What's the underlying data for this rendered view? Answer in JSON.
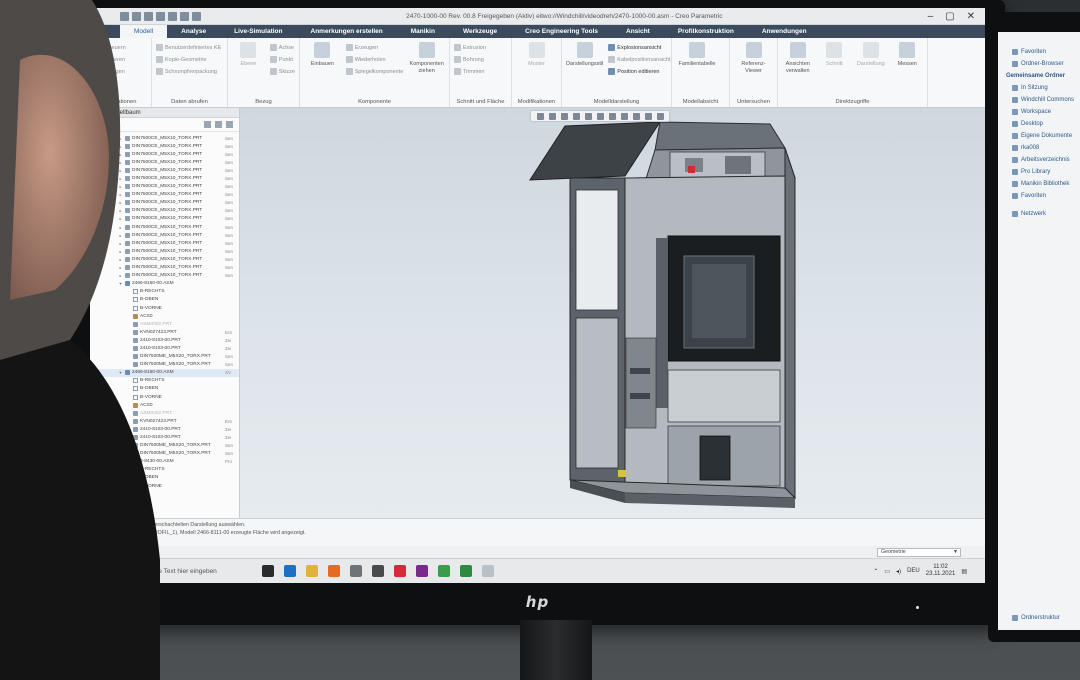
{
  "window": {
    "title": "2470-1000-00 Rev. 00.8 Freigegeben  (Aktiv) eitwo://Windchill/videodreh/2470-1000-00.asm - Creo Parametric",
    "controls": [
      "–",
      "▢",
      "✕"
    ]
  },
  "ribbon": {
    "tabs": [
      {
        "label": "Modell",
        "active": true
      },
      {
        "label": "Analyse"
      },
      {
        "label": "Live-Simulation"
      },
      {
        "label": "Anmerkungen erstellen"
      },
      {
        "label": "Manikin"
      },
      {
        "label": "Werkzeuge"
      },
      {
        "label": "Creo Engineering Tools"
      },
      {
        "label": "Ansicht"
      },
      {
        "label": "Profilkonstruktion"
      },
      {
        "label": "Anwendungen"
      }
    ],
    "groups": {
      "operationen": {
        "label": "Operationen",
        "commands": [
          "Erneuern",
          "Kopieren",
          "Einfügen"
        ]
      },
      "daten_abrufen": {
        "label": "Daten abrufen",
        "commands": [
          "Benutzerdefiniertes KE",
          "Kopie-Geometrie",
          "Schrumpfverpackung"
        ]
      },
      "bezug": {
        "label": "Bezug",
        "commands": [
          "Ebene",
          "Achse",
          "Punkt",
          "Skizze"
        ]
      },
      "komponente": {
        "label": "Komponente",
        "big": [
          "Einbauen",
          "Komponenten ziehen"
        ],
        "commands": [
          "Erzeugen",
          "Wiederholen",
          "Spiegelkomponente"
        ]
      },
      "schnitt": {
        "label": "Schnitt und Fläche",
        "commands": [
          "Extrusion",
          "Bohrung",
          "Trimmen"
        ]
      },
      "modifikationen": {
        "label": "Modifikationen",
        "big": [
          "Muster"
        ]
      },
      "modelldarstellung": {
        "label": "Modelldarstellung",
        "big": [
          "Darstellungsstil"
        ],
        "commands": [
          "Explosionsansicht",
          "Kabelpositionsansicht",
          "Position editieren"
        ]
      },
      "modellabsicht": {
        "label": "Modellabsicht",
        "big": [
          "Familientabelle"
        ]
      },
      "untersuchen": {
        "label": "Untersuchen",
        "big": [
          "Referenz-Viewer"
        ]
      },
      "direktzugriffe": {
        "label": "Direktzugriffe",
        "big": [
          "Ansichten verwalten",
          "Schnitt",
          "Darstellung",
          "Messen"
        ]
      }
    }
  },
  "model_tree": {
    "header": "Modellbaum",
    "columns_label": "BENE",
    "rows": [
      {
        "label": "DIN7500CE_M5X10_TORX.PRT",
        "col": "Sen",
        "type": "part"
      },
      {
        "label": "DIN7500CE_M5X10_TORX.PRT",
        "col": "Sen",
        "type": "part"
      },
      {
        "label": "DIN7500CE_M5X10_TORX.PRT",
        "col": "Sen",
        "type": "part"
      },
      {
        "label": "DIN7500CE_M5X10_TORX.PRT",
        "col": "Sen",
        "type": "part"
      },
      {
        "label": "DIN7500CE_M5X10_TORX.PRT",
        "col": "Sen",
        "type": "part"
      },
      {
        "label": "DIN7500CE_M5X10_TORX.PRT",
        "col": "Sen",
        "type": "part"
      },
      {
        "label": "DIN7500CE_M5X10_TORX.PRT",
        "col": "Sen",
        "type": "part"
      },
      {
        "label": "DIN7500CE_M5X10_TORX.PRT",
        "col": "Sen",
        "type": "part"
      },
      {
        "label": "DIN7500CE_M5X10_TORX.PRT",
        "col": "Sen",
        "type": "part"
      },
      {
        "label": "DIN7500CE_M5X10_TORX.PRT",
        "col": "Sen",
        "type": "part"
      },
      {
        "label": "DIN7500CE_M5X10_TORX.PRT",
        "col": "Sen",
        "type": "part"
      },
      {
        "label": "DIN7500CE_M5X10_TORX.PRT",
        "col": "Sen",
        "type": "part"
      },
      {
        "label": "DIN7500CE_M5X10_TORX.PRT",
        "col": "Sen",
        "type": "part"
      },
      {
        "label": "DIN7500CE_M5X10_TORX.PRT",
        "col": "Sen",
        "type": "part"
      },
      {
        "label": "DIN7500CE_M5X10_TORX.PRT",
        "col": "Sen",
        "type": "part"
      },
      {
        "label": "DIN7500CE_M5X10_TORX.PRT",
        "col": "Sen",
        "type": "part"
      },
      {
        "label": "DIN7500CE_M5X10_TORX.PRT",
        "col": "Sen",
        "type": "part"
      },
      {
        "label": "DIN7500CE_M5X10_TORX.PRT",
        "col": "Sen",
        "type": "part"
      },
      {
        "label": "2466-8150-00.ASM",
        "col": "",
        "type": "asm"
      },
      {
        "label": "B-RECHTS",
        "col": "",
        "type": "plane",
        "indent": 1
      },
      {
        "label": "B-OBEN",
        "col": "",
        "type": "plane",
        "indent": 1
      },
      {
        "label": "B-VORNE",
        "col": "",
        "type": "plane",
        "indent": 1
      },
      {
        "label": "ACS0",
        "col": "",
        "type": "csys",
        "indent": 1
      },
      {
        "label": "ASM0002.PRT",
        "col": "",
        "type": "part",
        "indent": 1,
        "faded": true
      },
      {
        "label": "KVN027423.PRT",
        "col": "Ent",
        "type": "part",
        "indent": 1
      },
      {
        "label": "2410-8103-00.PRT",
        "col": "Zei",
        "type": "part",
        "indent": 1
      },
      {
        "label": "2410-8103-00.PRT",
        "col": "Zei",
        "type": "part",
        "indent": 1
      },
      {
        "label": "DIN7500ME_M5X20_TORX.PRT",
        "col": "Sen",
        "type": "part",
        "indent": 1
      },
      {
        "label": "DIN7500ME_M5X20_TORX.PRT",
        "col": "Sen",
        "type": "part",
        "indent": 1
      },
      {
        "label": "2466-8150-00.ASM",
        "col": "SV",
        "type": "asm",
        "sel": true
      },
      {
        "label": "B-RECHTS",
        "col": "",
        "type": "plane",
        "indent": 1
      },
      {
        "label": "B-OBEN",
        "col": "",
        "type": "plane",
        "indent": 1
      },
      {
        "label": "B-VORNE",
        "col": "",
        "type": "plane",
        "indent": 1
      },
      {
        "label": "ACS0",
        "col": "",
        "type": "csys",
        "indent": 1
      },
      {
        "label": "ASM0002.PRT",
        "col": "",
        "type": "part",
        "indent": 1,
        "faded": true
      },
      {
        "label": "KVN027423.PRT",
        "col": "Ent",
        "type": "part",
        "indent": 1
      },
      {
        "label": "2410-8103-00.PRT",
        "col": "Zei",
        "type": "part",
        "indent": 1
      },
      {
        "label": "2410-8103-00.PRT",
        "col": "Zei",
        "type": "part",
        "indent": 1
      },
      {
        "label": "DIN7500ME_M5X20_TORX.PRT",
        "col": "Sen",
        "type": "part",
        "indent": 1
      },
      {
        "label": "DIN7500ME_M5X20_TORX.PRT",
        "col": "Sen",
        "type": "part",
        "indent": 1
      },
      {
        "label": "2466-8430-00.ASM",
        "col": "Pro",
        "type": "asm"
      },
      {
        "label": "B-RECHTS",
        "col": "",
        "type": "plane",
        "indent": 1
      },
      {
        "label": "B-OBEN",
        "col": "",
        "type": "plane",
        "indent": 1
      },
      {
        "label": "B-VORNE",
        "col": "",
        "type": "plane",
        "indent": 1
      }
    ]
  },
  "messages": [
    "Namen einer verschachtelten Darstellung auswählen.",
    "Durch KE 3 (PROFIL_1), Modell 2466-8111-00 erzeugte Fläche wird angezeigt."
  ],
  "status": {
    "filter_value": "Geometrie"
  },
  "taskbar": {
    "search_placeholder": "Zur Suche Text hier eingeben",
    "apps": [
      {
        "name": "task-view",
        "color": "#2b2b2b"
      },
      {
        "name": "outlook",
        "color": "#1f6fc4"
      },
      {
        "name": "explorer",
        "color": "#e2b33b"
      },
      {
        "name": "firefox",
        "color": "#e66a1f"
      },
      {
        "name": "app-gray",
        "color": "#6e7378"
      },
      {
        "name": "app-dark",
        "color": "#4a4a4a"
      },
      {
        "name": "vivaldi",
        "color": "#d8293a"
      },
      {
        "name": "onenote",
        "color": "#7a2a8a"
      },
      {
        "name": "creo-1",
        "color": "#3a9d4a"
      },
      {
        "name": "creo-2",
        "color": "#2f8a3f"
      },
      {
        "name": "app-light",
        "color": "#b9c0c6"
      }
    ],
    "lang": "DEU",
    "time": "11:02",
    "date": "23.11.2021"
  },
  "second_monitor": {
    "items_top": [
      "Favoriten",
      "Ordner-Browser"
    ],
    "heading": "Gemeinsame Ordner",
    "items": [
      "In Sitzung",
      "Windchill Commons",
      "Workspace",
      "Desktop",
      "Eigene Dokumente",
      "rka008",
      "Arbeitsverzeichnis",
      "Pro Library",
      "Manikin Bibliothek",
      "Favoriten"
    ],
    "network": "Netzwerk",
    "footer": "Ordnerstruktur"
  },
  "monitor": {
    "brand": "hp"
  },
  "colors": {
    "ribbon_tab_bg": "#3b4a5c",
    "accent": "#2b5f9e",
    "viewport_top": "#cfd7df"
  }
}
